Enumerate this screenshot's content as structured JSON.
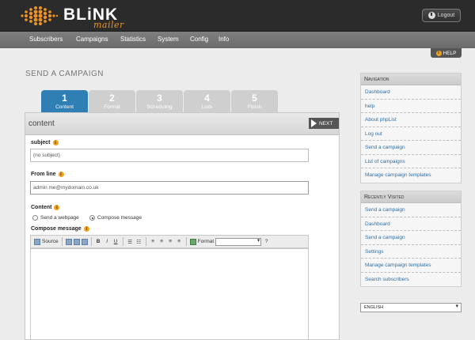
{
  "brand": {
    "word": "BLiNK",
    "sub": "mailer",
    "accent": "#f0931e"
  },
  "header": {
    "logout_label": "Logout"
  },
  "nav": {
    "items": [
      "Subscribers",
      "Campaigns",
      "Statistics",
      "System",
      "Config",
      "Info"
    ]
  },
  "help_label": "HELP",
  "page_title": "SEND A CAMPAIGN",
  "tabs": [
    {
      "num": "1",
      "label": "Content",
      "active": true
    },
    {
      "num": "2",
      "label": "Format",
      "active": false
    },
    {
      "num": "3",
      "label": "Scheduling",
      "active": false
    },
    {
      "num": "4",
      "label": "Lists",
      "active": false
    },
    {
      "num": "5",
      "label": "Finish",
      "active": false
    }
  ],
  "form": {
    "section_title": "content",
    "next_label": "NEXT",
    "subject_label": "subject",
    "subject_value": "(no subject)",
    "from_label": "From line",
    "from_value": "admin me@mydomain.co.uk",
    "content_label": "Content",
    "radio_webpage": "Send a webpage",
    "radio_compose": "Compose message",
    "compose_label": "Compose message",
    "toolbar_source": "Source",
    "toolbar_bold": "B",
    "toolbar_italic": "I",
    "toolbar_underline": "U",
    "toolbar_format": "Format"
  },
  "sidebar": {
    "navigation_title": "Navigation",
    "navigation_links": [
      "Dashboard",
      "help",
      "About phpList",
      "Log out",
      "Send a campaign",
      "List of campaigns",
      "Manage campaign templates"
    ],
    "recent_title": "Recently Visited",
    "recent_links": [
      "Send a campaign",
      "Dashboard",
      "Send a campaign",
      "Settings",
      "Manage campaign templates",
      "Search subscribers"
    ],
    "language": "ENGLISH"
  }
}
